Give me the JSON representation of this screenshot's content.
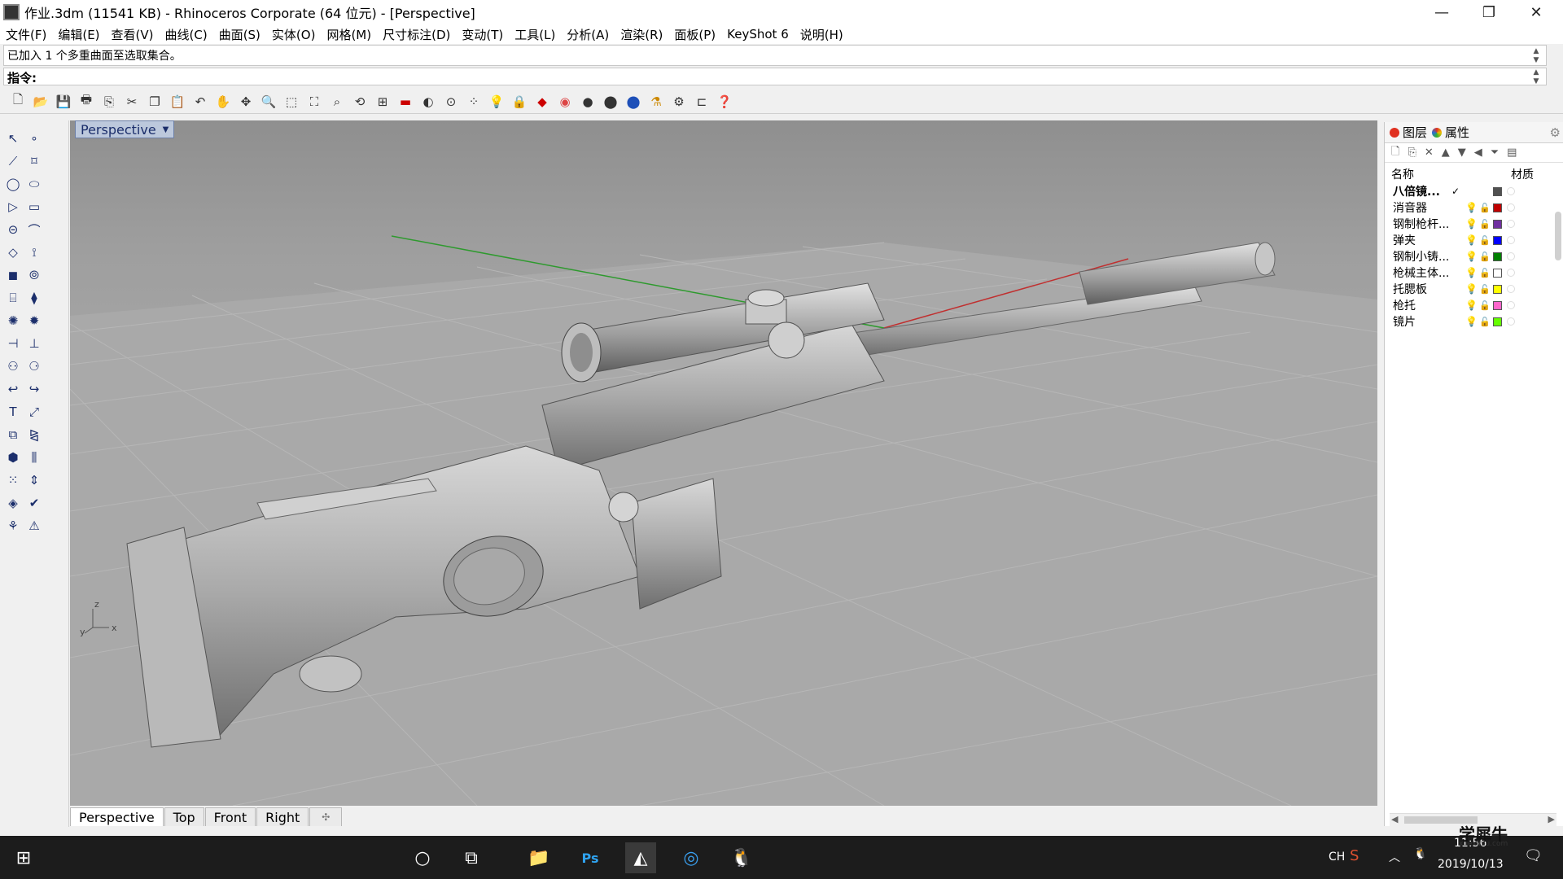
{
  "window": {
    "title": "作业.3dm (11541 KB) - Rhinoceros Corporate (64 位元) - [Perspective]",
    "minimize": "—",
    "maximize": "❐",
    "close": "✕"
  },
  "menu": [
    "文件(F)",
    "编辑(E)",
    "查看(V)",
    "曲线(C)",
    "曲面(S)",
    "实体(O)",
    "网格(M)",
    "尺寸标注(D)",
    "变动(T)",
    "工具(L)",
    "分析(A)",
    "渲染(R)",
    "面板(P)",
    "KeyShot 6",
    "说明(H)"
  ],
  "command": {
    "history": "已加入 1 个多重曲面至选取集合。",
    "prompt": "指令:"
  },
  "viewport": {
    "label": "Perspective",
    "axis_z": "z",
    "axis_y": "y",
    "axis_x": "x",
    "tabs": [
      "Perspective",
      "Top",
      "Front",
      "Right"
    ],
    "add_tab": "✣"
  },
  "panel": {
    "tabs": [
      {
        "label": "图层",
        "color": "#e03020"
      },
      {
        "label": "属性",
        "color": "#2a6fd6"
      }
    ],
    "col_name": "名称",
    "col_material": "材质",
    "layers": [
      {
        "name": "八倍镜...",
        "current": "✓",
        "color": "#505050",
        "bold": true
      },
      {
        "name": "消音器",
        "color": "#c00000"
      },
      {
        "name": "钢制枪杆...",
        "color": "#7030a0"
      },
      {
        "name": "弹夹",
        "color": "#0000ff"
      },
      {
        "name": "钢制小铸...",
        "color": "#008000"
      },
      {
        "name": "枪械主体...",
        "color": "#ffffff"
      },
      {
        "name": "托腮板",
        "color": "#ffff00"
      },
      {
        "name": "枪托",
        "color": "#ff66cc"
      },
      {
        "name": "镜片",
        "color": "#66ff00"
      }
    ]
  },
  "taskbar": {
    "ime": "CH",
    "time": "11:56",
    "date": "2019/10/13",
    "watermark": "学犀牛",
    "watermark_url": "xuexiniu.com"
  }
}
